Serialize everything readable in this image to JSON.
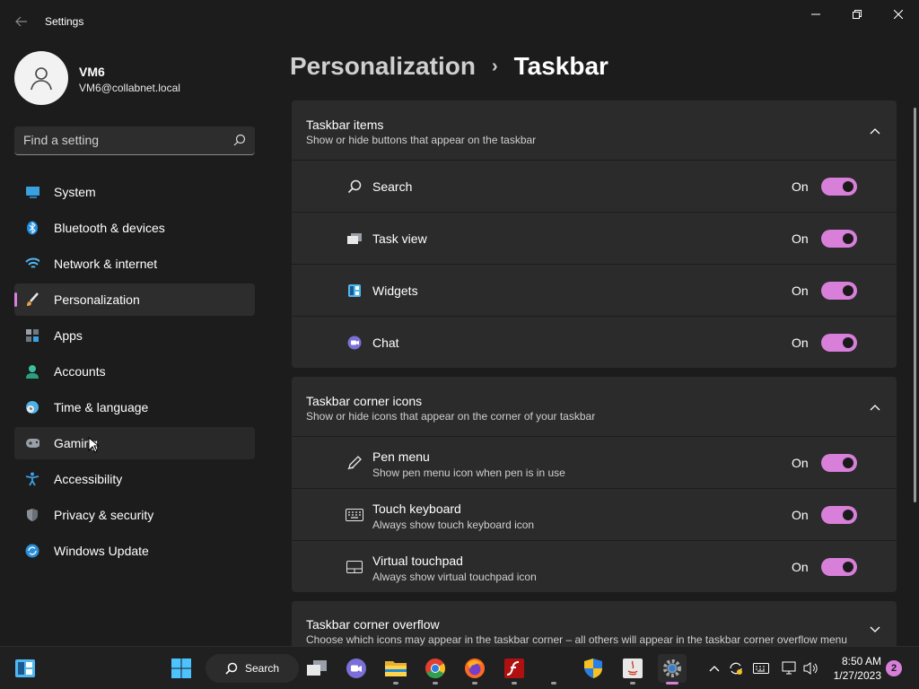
{
  "window": {
    "title": "Settings"
  },
  "user": {
    "name": "VM6",
    "email": "VM6@collabnet.local"
  },
  "search": {
    "placeholder": "Find a setting"
  },
  "sidebar": {
    "items": [
      {
        "label": "System",
        "icon": "system-icon"
      },
      {
        "label": "Bluetooth & devices",
        "icon": "bluetooth-icon"
      },
      {
        "label": "Network & internet",
        "icon": "wifi-icon"
      },
      {
        "label": "Personalization",
        "icon": "brush-icon",
        "active": true
      },
      {
        "label": "Apps",
        "icon": "apps-icon"
      },
      {
        "label": "Accounts",
        "icon": "person-icon"
      },
      {
        "label": "Time & language",
        "icon": "clock-globe-icon"
      },
      {
        "label": "Gaming",
        "icon": "gamepad-icon"
      },
      {
        "label": "Accessibility",
        "icon": "accessibility-icon"
      },
      {
        "label": "Privacy & security",
        "icon": "shield-icon"
      },
      {
        "label": "Windows Update",
        "icon": "update-icon"
      }
    ]
  },
  "breadcrumb": {
    "parent": "Personalization",
    "separator": "›",
    "current": "Taskbar"
  },
  "sections": {
    "taskbar_items": {
      "title": "Taskbar items",
      "subtitle": "Show or hide buttons that appear on the taskbar",
      "rows": [
        {
          "label": "Search",
          "state": "On"
        },
        {
          "label": "Task view",
          "state": "On"
        },
        {
          "label": "Widgets",
          "state": "On"
        },
        {
          "label": "Chat",
          "state": "On"
        }
      ]
    },
    "corner_icons": {
      "title": "Taskbar corner icons",
      "subtitle": "Show or hide icons that appear on the corner of your taskbar",
      "rows": [
        {
          "label": "Pen menu",
          "desc": "Show pen menu icon when pen is in use",
          "state": "On"
        },
        {
          "label": "Touch keyboard",
          "desc": "Always show touch keyboard icon",
          "state": "On"
        },
        {
          "label": "Virtual touchpad",
          "desc": "Always show virtual touchpad icon",
          "state": "On"
        }
      ]
    },
    "corner_overflow": {
      "title": "Taskbar corner overflow",
      "subtitle": "Choose which icons may appear in the taskbar corner – all others will appear in the taskbar corner overflow menu"
    }
  },
  "taskbar": {
    "search_label": "Search",
    "time": "8:50 AM",
    "date": "1/27/2023",
    "notifications": "2"
  },
  "colors": {
    "accent": "#d77fd9",
    "background": "#1c1c1c",
    "card": "#2b2b2b"
  }
}
